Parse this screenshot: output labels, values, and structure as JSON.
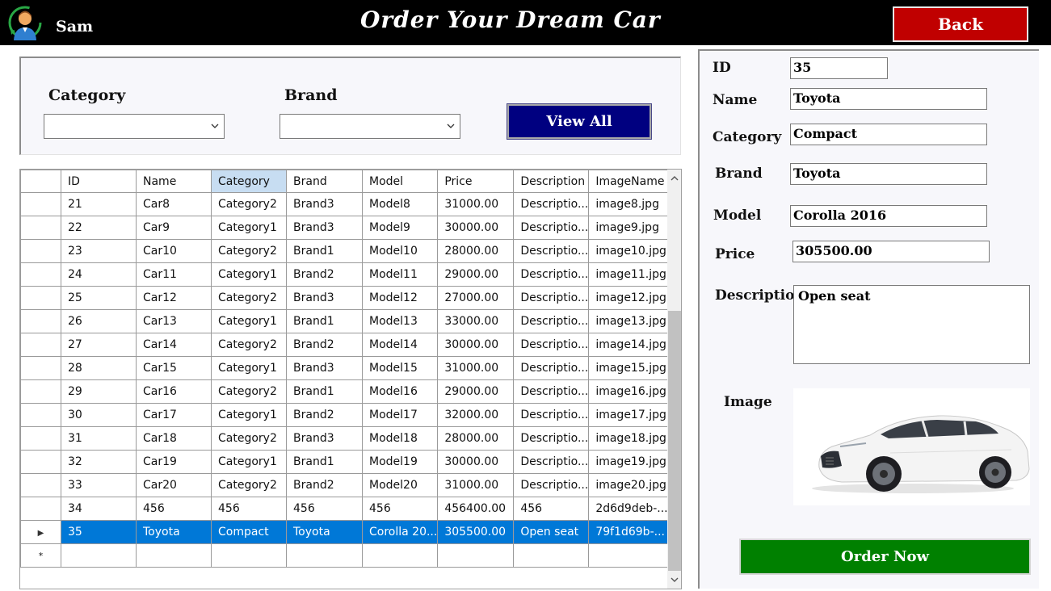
{
  "header": {
    "user_name": "Sam",
    "title": "Order Your Dream Car",
    "back_label": "Back"
  },
  "filters": {
    "category_label": "Category",
    "category_value": "",
    "brand_label": "Brand",
    "brand_value": "",
    "view_all_label": "View All"
  },
  "grid": {
    "columns": [
      "ID",
      "Name",
      "Category",
      "Brand",
      "Model",
      "Price",
      "Description",
      "ImageName"
    ],
    "rows": [
      [
        "21",
        "Car8",
        "Category2",
        "Brand3",
        "Model8",
        "31000.00",
        "Descriptio...",
        "image8.jpg"
      ],
      [
        "22",
        "Car9",
        "Category1",
        "Brand3",
        "Model9",
        "30000.00",
        "Descriptio...",
        "image9.jpg"
      ],
      [
        "23",
        "Car10",
        "Category2",
        "Brand1",
        "Model10",
        "28000.00",
        "Descriptio...",
        "image10.jpg"
      ],
      [
        "24",
        "Car11",
        "Category1",
        "Brand2",
        "Model11",
        "29000.00",
        "Descriptio...",
        "image11.jpg"
      ],
      [
        "25",
        "Car12",
        "Category2",
        "Brand3",
        "Model12",
        "27000.00",
        "Descriptio...",
        "image12.jpg"
      ],
      [
        "26",
        "Car13",
        "Category1",
        "Brand1",
        "Model13",
        "33000.00",
        "Descriptio...",
        "image13.jpg"
      ],
      [
        "27",
        "Car14",
        "Category2",
        "Brand2",
        "Model14",
        "30000.00",
        "Descriptio...",
        "image14.jpg"
      ],
      [
        "28",
        "Car15",
        "Category1",
        "Brand3",
        "Model15",
        "31000.00",
        "Descriptio...",
        "image15.jpg"
      ],
      [
        "29",
        "Car16",
        "Category2",
        "Brand1",
        "Model16",
        "29000.00",
        "Descriptio...",
        "image16.jpg"
      ],
      [
        "30",
        "Car17",
        "Category1",
        "Brand2",
        "Model17",
        "32000.00",
        "Descriptio...",
        "image17.jpg"
      ],
      [
        "31",
        "Car18",
        "Category2",
        "Brand3",
        "Model18",
        "28000.00",
        "Descriptio...",
        "image18.jpg"
      ],
      [
        "32",
        "Car19",
        "Category1",
        "Brand1",
        "Model19",
        "30000.00",
        "Descriptio...",
        "image19.jpg"
      ],
      [
        "33",
        "Car20",
        "Category2",
        "Brand2",
        "Model20",
        "31000.00",
        "Descriptio...",
        "image20.jpg"
      ],
      [
        "34",
        "456",
        "456",
        "456",
        "456",
        "456400.00",
        "456",
        "2d6d9deb-..."
      ],
      [
        "35",
        "Toyota",
        "Compact",
        "Toyota",
        "Corolla 20...",
        "305500.00",
        "Open seat",
        "79f1d69b-..."
      ]
    ],
    "selected_row_index": 14,
    "current_row_marker": "▶",
    "new_row_marker": "*"
  },
  "details": {
    "id_label": "ID",
    "id_value": "35",
    "name_label": "Name",
    "name_value": "Toyota",
    "category_label": "Category",
    "category_value": "Compact",
    "brand_label": "Brand",
    "brand_value": "Toyota",
    "model_label": "Model",
    "model_value": "Corolla 2016",
    "price_label": "Price",
    "price_value": "305500.00",
    "description_label": "Description",
    "description_value": "Open seat",
    "image_label": "Image"
  },
  "order_now_label": "Order Now",
  "colors": {
    "header_bg": "#000000",
    "back_btn": "#c00000",
    "view_all_btn": "#000080",
    "order_btn": "#008000",
    "selection": "#0078d7",
    "panel_bg": "#f7f7fb"
  }
}
